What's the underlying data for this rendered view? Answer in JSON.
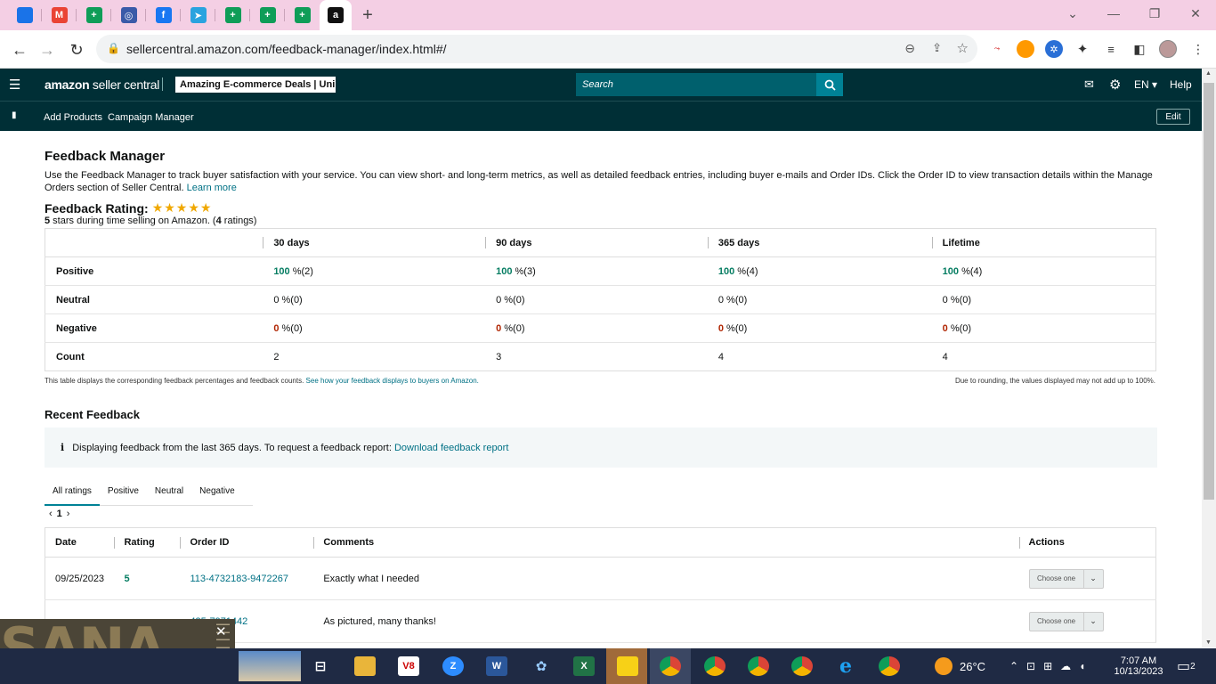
{
  "browser": {
    "tabs": [
      {
        "icon": "window-icon",
        "color": "#1a73e8",
        "label": ""
      },
      {
        "icon": "gmail-icon",
        "color": "#ea4335",
        "label": "M"
      },
      {
        "icon": "sheets-icon",
        "color": "#0f9d58",
        "label": "+"
      },
      {
        "icon": "globe-icon",
        "color": "#3a5aa8",
        "label": "◎"
      },
      {
        "icon": "facebook-icon",
        "color": "#1877f2",
        "label": "f"
      },
      {
        "icon": "telegram-icon",
        "color": "#2aa3df",
        "label": "➤"
      },
      {
        "icon": "sheets-icon",
        "color": "#0f9d58",
        "label": "+"
      },
      {
        "icon": "sheets-icon",
        "color": "#0f9d58",
        "label": "+"
      },
      {
        "icon": "sheets-icon",
        "color": "#0f9d58",
        "label": "+"
      },
      {
        "icon": "amazon-icon",
        "color": "#111111",
        "label": "a"
      }
    ],
    "new_tab": "+",
    "url": "sellercentral.amazon.com/feedback-manager/index.html#/"
  },
  "header": {
    "logo_amazon": "amazon",
    "logo_rest": " seller central",
    "store": "Amazing E-commerce Deals | Uni...",
    "search_placeholder": "Search",
    "lang": "EN ▾",
    "help": "Help"
  },
  "subnav": {
    "links": [
      "Add Products",
      "Campaign Manager"
    ],
    "edit": "Edit"
  },
  "page": {
    "title": "Feedback Manager",
    "description": "Use the Feedback Manager to track buyer satisfaction with your service. You can view short- and long-term metrics, as well as detailed feedback entries, including buyer e-mails and Order IDs. Click the Order ID to view transaction details within the Manage Orders section of Seller Central.",
    "learn_more": "Learn more",
    "rating_label": "Feedback Rating:",
    "stars": "★★★★★",
    "rating_value": 5,
    "summary_stars": "5",
    "summary_mid": " stars during time selling on Amazon. (",
    "summary_count": "4",
    "summary_end": " ratings)"
  },
  "feedback_table": {
    "columns": [
      "",
      "30 days",
      "90 days",
      "365 days",
      "Lifetime"
    ],
    "rows": [
      {
        "label": "Positive",
        "cells": [
          [
            "100",
            " %(2)"
          ],
          [
            "100",
            " %(3)"
          ],
          [
            "100",
            " %(4)"
          ],
          [
            "100",
            " %(4)"
          ]
        ],
        "color": "g"
      },
      {
        "label": "Neutral",
        "cells": [
          [
            "0",
            " %(0)"
          ],
          [
            "0",
            " %(0)"
          ],
          [
            "0",
            " %(0)"
          ],
          [
            "0",
            " %(0)"
          ]
        ],
        "color": ""
      },
      {
        "label": "Negative",
        "cells": [
          [
            "0",
            " %(0)"
          ],
          [
            "0",
            " %(0)"
          ],
          [
            "0",
            " %(0)"
          ],
          [
            "0",
            " %(0)"
          ]
        ],
        "color": "r"
      },
      {
        "label": "Count",
        "cells": [
          [
            "",
            "2"
          ],
          [
            "",
            "3"
          ],
          [
            "",
            "4"
          ],
          [
            "",
            "4"
          ]
        ],
        "color": ""
      }
    ],
    "note_left": "This table displays the corresponding feedback percentages and feedback counts.",
    "note_link": "See how your feedback displays to buyers on Amazon.",
    "note_right": "Due to rounding, the values displayed may not add up to 100%."
  },
  "recent": {
    "title": "Recent Feedback",
    "info_text": "Displaying feedback from the last 365 days. To request a feedback report:",
    "info_link": "Download feedback report",
    "tabs": [
      "All ratings",
      "Positive",
      "Neutral",
      "Negative"
    ],
    "page": "1",
    "columns": [
      "Date",
      "Rating",
      "Order ID",
      "Comments",
      "Actions"
    ],
    "rows": [
      {
        "date": "09/25/2023",
        "rating": "5",
        "order": "113-4732183-9472267",
        "comment": "Exactly what I needed",
        "action": "Choose one"
      },
      {
        "date": "",
        "rating": "",
        "order": "435-7971442",
        "comment": "As pictured, many thanks!",
        "action": "Choose one"
      }
    ]
  },
  "overlay": {
    "title": "SANA",
    "close": "✕"
  },
  "taskbar": {
    "weather": "26°C",
    "time": "7:07 AM",
    "date": "10/13/2023",
    "notifications": "2"
  }
}
